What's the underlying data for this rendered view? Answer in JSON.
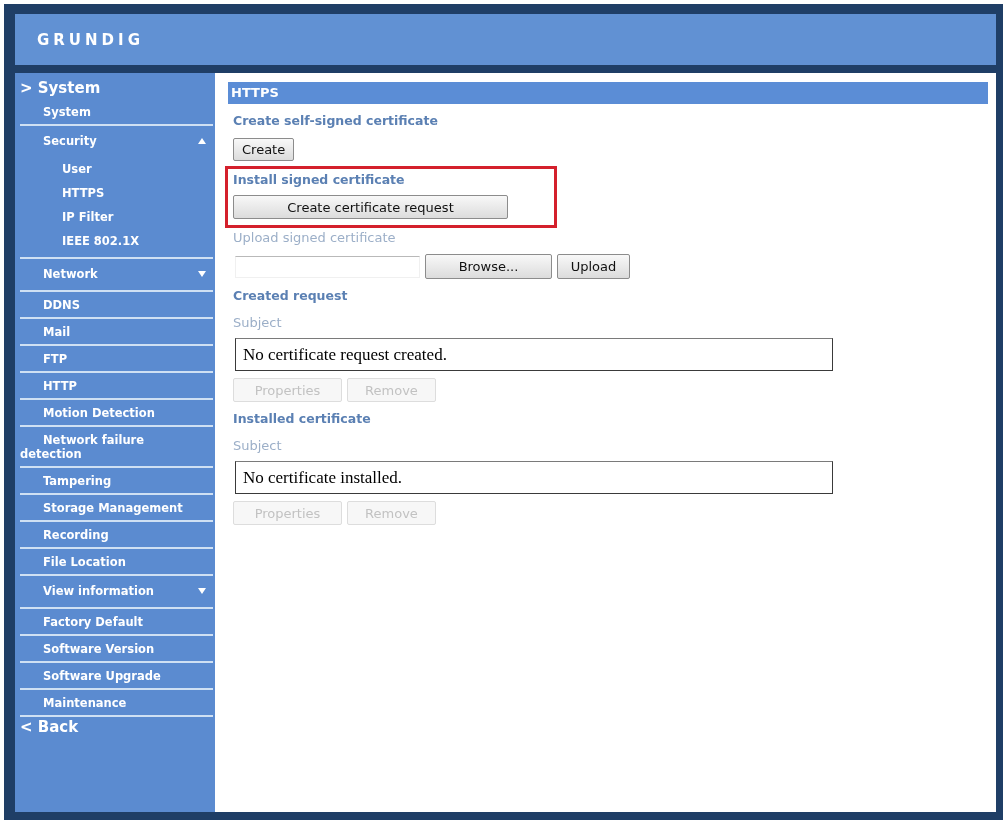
{
  "header": {
    "logo": "GRUNDIG"
  },
  "sidebar": {
    "title": "> System",
    "items": [
      {
        "kind": "link",
        "label": "System"
      },
      {
        "kind": "group",
        "label": "Security",
        "expanded": true,
        "children": [
          {
            "label": "User"
          },
          {
            "label": "HTTPS"
          },
          {
            "label": "IP Filter"
          },
          {
            "label": "IEEE 802.1X"
          }
        ]
      },
      {
        "kind": "group",
        "label": "Network",
        "expanded": false
      },
      {
        "kind": "link",
        "label": "DDNS"
      },
      {
        "kind": "link",
        "label": "Mail"
      },
      {
        "kind": "link",
        "label": "FTP"
      },
      {
        "kind": "link",
        "label": "HTTP"
      },
      {
        "kind": "link",
        "label": "Motion Detection"
      },
      {
        "kind": "link",
        "label": "Network failure detection"
      },
      {
        "kind": "link",
        "label": "Tampering"
      },
      {
        "kind": "link",
        "label": "Storage Management"
      },
      {
        "kind": "link",
        "label": "Recording"
      },
      {
        "kind": "link",
        "label": "File Location"
      },
      {
        "kind": "group",
        "label": "View information",
        "expanded": false
      },
      {
        "kind": "link",
        "label": "Factory Default"
      },
      {
        "kind": "link",
        "label": "Software Version"
      },
      {
        "kind": "link",
        "label": "Software Upgrade"
      },
      {
        "kind": "link",
        "label": "Maintenance"
      }
    ],
    "back": "< Back"
  },
  "page": {
    "title": "HTTPS",
    "sections": [
      {
        "kind": "create",
        "heading": "Create self-signed certificate",
        "buttons": [
          {
            "label": "Create",
            "disabled": false
          }
        ]
      },
      {
        "kind": "request",
        "heading": "Install signed certificate",
        "highlighted": true,
        "buttons": [
          {
            "label": "Create certificate request",
            "disabled": false
          }
        ]
      },
      {
        "kind": "upload",
        "label": "Upload signed certificate",
        "buttons": [
          {
            "label": "Browse...",
            "disabled": false
          },
          {
            "label": "Upload",
            "disabled": false
          }
        ]
      },
      {
        "kind": "subject",
        "heading": "Created request",
        "label": "Subject",
        "value": "No certificate request created.",
        "buttons": [
          {
            "label": "Properties",
            "disabled": true
          },
          {
            "label": "Remove",
            "disabled": true
          }
        ]
      },
      {
        "kind": "subject",
        "heading": "Installed certificate",
        "label": "Subject",
        "value": "No certificate installed.",
        "buttons": [
          {
            "label": "Properties",
            "disabled": true
          },
          {
            "label": "Remove",
            "disabled": true
          }
        ]
      }
    ]
  }
}
